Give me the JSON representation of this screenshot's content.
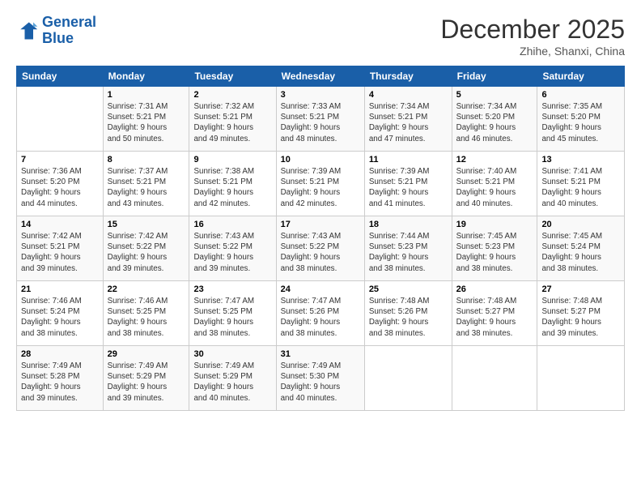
{
  "logo": {
    "line1": "General",
    "line2": "Blue"
  },
  "title": "December 2025",
  "location": "Zhihe, Shanxi, China",
  "days_of_week": [
    "Sunday",
    "Monday",
    "Tuesday",
    "Wednesday",
    "Thursday",
    "Friday",
    "Saturday"
  ],
  "weeks": [
    [
      {
        "day": "",
        "data": ""
      },
      {
        "day": "1",
        "data": "Sunrise: 7:31 AM\nSunset: 5:21 PM\nDaylight: 9 hours\nand 50 minutes."
      },
      {
        "day": "2",
        "data": "Sunrise: 7:32 AM\nSunset: 5:21 PM\nDaylight: 9 hours\nand 49 minutes."
      },
      {
        "day": "3",
        "data": "Sunrise: 7:33 AM\nSunset: 5:21 PM\nDaylight: 9 hours\nand 48 minutes."
      },
      {
        "day": "4",
        "data": "Sunrise: 7:34 AM\nSunset: 5:21 PM\nDaylight: 9 hours\nand 47 minutes."
      },
      {
        "day": "5",
        "data": "Sunrise: 7:34 AM\nSunset: 5:20 PM\nDaylight: 9 hours\nand 46 minutes."
      },
      {
        "day": "6",
        "data": "Sunrise: 7:35 AM\nSunset: 5:20 PM\nDaylight: 9 hours\nand 45 minutes."
      }
    ],
    [
      {
        "day": "7",
        "data": "Sunrise: 7:36 AM\nSunset: 5:20 PM\nDaylight: 9 hours\nand 44 minutes."
      },
      {
        "day": "8",
        "data": "Sunrise: 7:37 AM\nSunset: 5:21 PM\nDaylight: 9 hours\nand 43 minutes."
      },
      {
        "day": "9",
        "data": "Sunrise: 7:38 AM\nSunset: 5:21 PM\nDaylight: 9 hours\nand 42 minutes."
      },
      {
        "day": "10",
        "data": "Sunrise: 7:39 AM\nSunset: 5:21 PM\nDaylight: 9 hours\nand 42 minutes."
      },
      {
        "day": "11",
        "data": "Sunrise: 7:39 AM\nSunset: 5:21 PM\nDaylight: 9 hours\nand 41 minutes."
      },
      {
        "day": "12",
        "data": "Sunrise: 7:40 AM\nSunset: 5:21 PM\nDaylight: 9 hours\nand 40 minutes."
      },
      {
        "day": "13",
        "data": "Sunrise: 7:41 AM\nSunset: 5:21 PM\nDaylight: 9 hours\nand 40 minutes."
      }
    ],
    [
      {
        "day": "14",
        "data": "Sunrise: 7:42 AM\nSunset: 5:21 PM\nDaylight: 9 hours\nand 39 minutes."
      },
      {
        "day": "15",
        "data": "Sunrise: 7:42 AM\nSunset: 5:22 PM\nDaylight: 9 hours\nand 39 minutes."
      },
      {
        "day": "16",
        "data": "Sunrise: 7:43 AM\nSunset: 5:22 PM\nDaylight: 9 hours\nand 39 minutes."
      },
      {
        "day": "17",
        "data": "Sunrise: 7:43 AM\nSunset: 5:22 PM\nDaylight: 9 hours\nand 38 minutes."
      },
      {
        "day": "18",
        "data": "Sunrise: 7:44 AM\nSunset: 5:23 PM\nDaylight: 9 hours\nand 38 minutes."
      },
      {
        "day": "19",
        "data": "Sunrise: 7:45 AM\nSunset: 5:23 PM\nDaylight: 9 hours\nand 38 minutes."
      },
      {
        "day": "20",
        "data": "Sunrise: 7:45 AM\nSunset: 5:24 PM\nDaylight: 9 hours\nand 38 minutes."
      }
    ],
    [
      {
        "day": "21",
        "data": "Sunrise: 7:46 AM\nSunset: 5:24 PM\nDaylight: 9 hours\nand 38 minutes."
      },
      {
        "day": "22",
        "data": "Sunrise: 7:46 AM\nSunset: 5:25 PM\nDaylight: 9 hours\nand 38 minutes."
      },
      {
        "day": "23",
        "data": "Sunrise: 7:47 AM\nSunset: 5:25 PM\nDaylight: 9 hours\nand 38 minutes."
      },
      {
        "day": "24",
        "data": "Sunrise: 7:47 AM\nSunset: 5:26 PM\nDaylight: 9 hours\nand 38 minutes."
      },
      {
        "day": "25",
        "data": "Sunrise: 7:48 AM\nSunset: 5:26 PM\nDaylight: 9 hours\nand 38 minutes."
      },
      {
        "day": "26",
        "data": "Sunrise: 7:48 AM\nSunset: 5:27 PM\nDaylight: 9 hours\nand 38 minutes."
      },
      {
        "day": "27",
        "data": "Sunrise: 7:48 AM\nSunset: 5:27 PM\nDaylight: 9 hours\nand 39 minutes."
      }
    ],
    [
      {
        "day": "28",
        "data": "Sunrise: 7:49 AM\nSunset: 5:28 PM\nDaylight: 9 hours\nand 39 minutes."
      },
      {
        "day": "29",
        "data": "Sunrise: 7:49 AM\nSunset: 5:29 PM\nDaylight: 9 hours\nand 39 minutes."
      },
      {
        "day": "30",
        "data": "Sunrise: 7:49 AM\nSunset: 5:29 PM\nDaylight: 9 hours\nand 40 minutes."
      },
      {
        "day": "31",
        "data": "Sunrise: 7:49 AM\nSunset: 5:30 PM\nDaylight: 9 hours\nand 40 minutes."
      },
      {
        "day": "",
        "data": ""
      },
      {
        "day": "",
        "data": ""
      },
      {
        "day": "",
        "data": ""
      }
    ]
  ]
}
